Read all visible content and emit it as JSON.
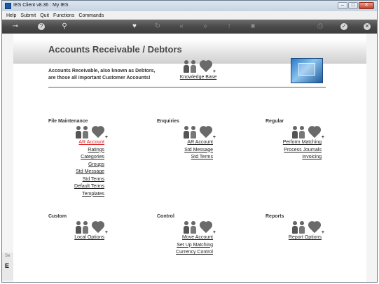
{
  "window": {
    "title": "IES Client v8.36 : My IES"
  },
  "menu": [
    "Help",
    "Submit",
    "Quit",
    "Functions",
    "Commands"
  ],
  "page": {
    "title": "Accounts Receivable / Debtors",
    "intro_line1": "Accounts Receivable, also known as Debtors,",
    "intro_line2": "are those  all important Customer Accounts!",
    "knowledge_base": "Knowledge Base"
  },
  "sections": {
    "file_maintenance": {
      "title": "File Maintenance",
      "links": [
        "AR Account",
        "Ratings",
        "Categories",
        "Groups",
        "Std Message",
        "Std Terms",
        "Default Terms",
        "Templates"
      ]
    },
    "enquiries": {
      "title": "Enquiries",
      "links": [
        "AR Account",
        "Std Message",
        "Std Terms"
      ]
    },
    "regular": {
      "title": "Regular",
      "links": [
        "Perform Matching",
        "Process Journals",
        "Invoicing"
      ]
    },
    "custom": {
      "title": "Custom",
      "links": [
        "Local Options"
      ]
    },
    "control": {
      "title": "Control",
      "links": [
        "Move Account",
        "Set Up Matching",
        "Currency Control"
      ]
    },
    "reports": {
      "title": "Reports",
      "links": [
        "Report Options"
      ]
    }
  },
  "status": {
    "left_top": "Se",
    "left_bottom": "E"
  }
}
